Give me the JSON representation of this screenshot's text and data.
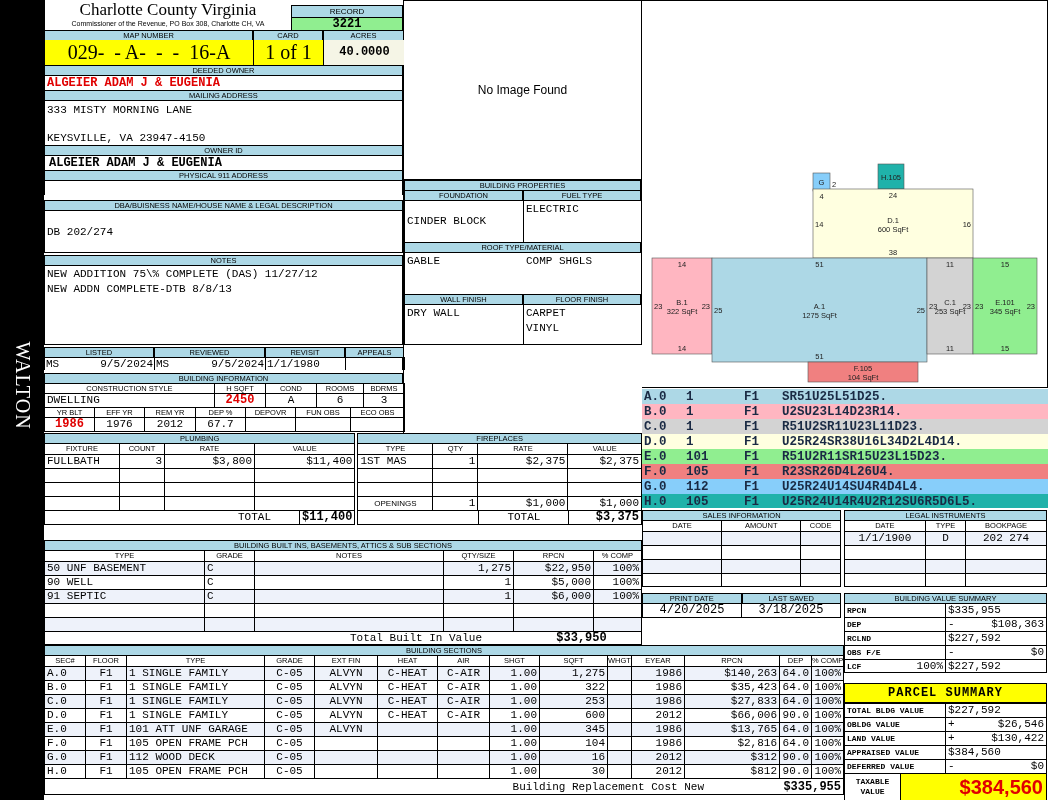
{
  "side_label": "WALTON",
  "header": {
    "county": "Charlotte County Virginia",
    "office": "Commissioner of the Revenue, PO Box 308, Charlotte CH, VA",
    "record_label": "RECORD",
    "record": "3221"
  },
  "parcel_id": [
    {
      "label": "MAP NUMBER",
      "value": "029-  - A-  -  -  16-A",
      "kind": "map"
    },
    {
      "label": "CARD",
      "value": "1 of 1",
      "kind": "map"
    },
    {
      "label": "ACRES",
      "value": "40.0000",
      "kind": "acres"
    }
  ],
  "owner_fields": [
    {
      "label": "DEEDED OWNER",
      "kind": "deeded",
      "lines": [
        "ALGEIER ADAM J & EUGENIA"
      ]
    },
    {
      "label": "MAILING ADDRESS",
      "kind": "address",
      "lines": [
        "333 MISTY MORNING LANE",
        "KEYSVILLE, VA 23947-4150"
      ]
    },
    {
      "label": "OWNER ID",
      "kind": "bold",
      "lines": [
        "ALGEIER ADAM J & EUGENIA"
      ]
    },
    {
      "label": "PHYSICAL 911 ADDRESS",
      "kind": "plain"
    }
  ],
  "description": {
    "label": "DBA/BUISNESS NAME/HOUSE NAME & LEGAL DESCRIPTION",
    "lines": [
      "DB 202/274"
    ]
  },
  "notes": {
    "label": "NOTES",
    "lines": [
      "NEW ADDITION 75\\% COMPLETE (DAS) 11/27/12",
      "NEW ADDN COMPLETE-DTB 8/8/13"
    ]
  },
  "dates": [
    {
      "label": "LISTED",
      "by": "MS",
      "date": "9/5/2024"
    },
    {
      "label": "REVIEWED",
      "by": "MS",
      "date": "9/5/2024"
    },
    {
      "label": "REVISIT",
      "date": "1/1/1980"
    },
    {
      "label": "APPEALS"
    }
  ],
  "building_info": {
    "title": "BUILDING INFORMATION",
    "style_row": [
      {
        "label": "CONSTRUCTION STYLE",
        "value": "DWELLING",
        "emphasis": false
      },
      {
        "label": "H SQFT",
        "value": "2450",
        "emphasis": true
      },
      {
        "label": "COND",
        "value": "A",
        "emphasis": false
      },
      {
        "label": "ROOMS",
        "value": "6",
        "emphasis": false
      },
      {
        "label": "BDRMS",
        "value": "3",
        "emphasis": false
      }
    ],
    "age_row": [
      {
        "label": "YR BLT",
        "value": "1986",
        "emphasis": true
      },
      {
        "label": "EFF YR",
        "value": "1976",
        "emphasis": false
      },
      {
        "label": "REM YR",
        "value": "2012",
        "emphasis": false
      },
      {
        "label": "DEP %",
        "value": "67.7",
        "emphasis": false
      },
      {
        "label": "DEPOVR"
      },
      {
        "label": "FUN OBS"
      },
      {
        "label": "ECO OBS"
      }
    ]
  },
  "image_box": {
    "text": "No Image Found"
  },
  "building_properties": {
    "title": "BUILDING PROPERTIES",
    "groups": [
      {
        "labels": [
          "FOUNDATION",
          "FUEL TYPE"
        ],
        "values": [
          [
            "CINDER BLOCK"
          ],
          [
            "ELECTRIC"
          ]
        ]
      },
      {
        "labels": [
          "ROOF TYPE/MATERIAL"
        ],
        "values": [
          [
            "GABLE"
          ],
          [
            "COMP SHGLS"
          ]
        ]
      },
      {
        "labels": [
          "WALL FINISH",
          "FLOOR FINISH"
        ],
        "values": [
          [
            "DRY WALL"
          ],
          [
            "CARPET",
            "VINYL"
          ]
        ]
      }
    ]
  },
  "sketch": {
    "areas": [
      {
        "label": "H.105",
        "color": "#20b2aa"
      },
      {
        "label": "G",
        "color": "#87cefa",
        "dims": [
          "2",
          "4"
        ]
      },
      {
        "label": "D.1",
        "area": "600 SqFt",
        "color": "#ffffe0",
        "dims": [
          "24",
          "14",
          "16",
          "38"
        ]
      },
      {
        "label": "B.1",
        "area": "322 SqFt",
        "color": "#ffb6c1",
        "dims": [
          "14",
          "14",
          "23",
          "23"
        ]
      },
      {
        "label": "A.1",
        "area": "1275 SqFt",
        "color": "#add8e6",
        "dims": [
          "51",
          "51",
          "25",
          "25"
        ]
      },
      {
        "label": "C.1",
        "area": "253 SqFt",
        "color": "#d3d3d3",
        "dims": [
          "11",
          "11",
          "23",
          "23"
        ]
      },
      {
        "label": "E.101",
        "area": "345 SqFt",
        "color": "#90ee90",
        "dims": [
          "15",
          "15",
          "23",
          "23"
        ]
      },
      {
        "label": "F.105",
        "area": "104 SqFt",
        "color": "#f08080"
      }
    ]
  },
  "section_vectors": [
    {
      "sec": "A.0",
      "code": "1",
      "floor": "F1",
      "vectors": "SR51U25L51D25.",
      "color": "#add8e6"
    },
    {
      "sec": "B.0",
      "code": "1",
      "floor": "F1",
      "vectors": "U2SU23L14D23R14.",
      "color": "#ffb6c1"
    },
    {
      "sec": "C.0",
      "code": "1",
      "floor": "F1",
      "vectors": "R51U2SR11U23L11D23.",
      "color": "#d3d3d3"
    },
    {
      "sec": "D.0",
      "code": "1",
      "floor": "F1",
      "vectors": "U25R24SR38U16L34D2L4D14.",
      "color": "#ffffe0"
    },
    {
      "sec": "E.0",
      "code": "101",
      "floor": "F1",
      "vectors": "R51U2R11SR15U23L15D23.",
      "color": "#90ee90"
    },
    {
      "sec": "F.0",
      "code": "105",
      "floor": "F1",
      "vectors": "R23SR26D4L26U4.",
      "color": "#f08080"
    },
    {
      "sec": "G.0",
      "code": "112",
      "floor": "F1",
      "vectors": "U25R24U14SU4R4D4L4.",
      "color": "#87cefa"
    },
    {
      "sec": "H.0",
      "code": "105",
      "floor": "F1",
      "vectors": "U25R24U14R4U2R12SU6R5D6L5.",
      "color": "#20b2aa"
    }
  ],
  "plumbing": {
    "title": "PLUMBING",
    "columns": [
      "FIXTURE",
      "COUNT",
      "RATE",
      "VALUE"
    ],
    "rows": [
      [
        "FULLBATH",
        "3",
        "$3,800",
        "$11,400"
      ]
    ],
    "total_label": "TOTAL",
    "total": "$11,400"
  },
  "fireplaces": {
    "title": "FIREPLACES",
    "columns": [
      "TYPE",
      "QTY",
      "RATE",
      "VALUE"
    ],
    "rows": [
      [
        "1ST MAS",
        "1",
        "$2,375",
        "$2,375"
      ]
    ],
    "openings": [
      "OPENINGS",
      "1",
      "$1,000",
      "$1,000"
    ],
    "total_label": "TOTAL",
    "total": "$3,375"
  },
  "built_ins": {
    "title": "BUILDING BUILT INS, BASEMENTS, ATTICS & SUB SECTIONS",
    "columns": [
      "TYPE",
      "GRADE",
      "NOTES",
      "QTY/SIZE",
      "RPCN",
      "% COMP"
    ],
    "rows": [
      {
        "type": "50 UNF BASEMENT",
        "grade": "C",
        "qty": "1,275",
        "rpcn": "$22,950",
        "comp": "100%"
      },
      {
        "type": "90 WELL",
        "grade": "C",
        "qty": "1",
        "rpcn": "$5,000",
        "comp": "100%"
      },
      {
        "type": "91 SEPTIC",
        "grade": "C",
        "qty": "1",
        "rpcn": "$6,000",
        "comp": "100%"
      }
    ],
    "total_label": "Total Built In Value",
    "total": "$33,950"
  },
  "building_sections": {
    "title": "BUILDING SECTIONS",
    "columns": [
      "SEC#",
      "FLOOR",
      "TYPE",
      "GRADE",
      "EXT FIN",
      "HEAT",
      "AIR",
      "SHGT",
      "SQFT",
      "WHGT",
      "EYEAR",
      "RPCN",
      "DEP",
      "% COMP"
    ],
    "rows": [
      {
        "sec": "A.0",
        "floor": "F1",
        "type": "1 SINGLE FAMILY",
        "grade": "C-05",
        "ext_fin": "ALVYN",
        "heat": "C-HEAT",
        "air": "C-AIR",
        "shgt": "1.00",
        "sqft": "1,275",
        "eyear": "1986",
        "rpcn": "$140,263",
        "dep": "64.0",
        "comp": "100%"
      },
      {
        "sec": "B.0",
        "floor": "F1",
        "type": "1 SINGLE FAMILY",
        "grade": "C-05",
        "ext_fin": "ALVYN",
        "heat": "C-HEAT",
        "air": "C-AIR",
        "shgt": "1.00",
        "sqft": "322",
        "eyear": "1986",
        "rpcn": "$35,423",
        "dep": "64.0",
        "comp": "100%"
      },
      {
        "sec": "C.0",
        "floor": "F1",
        "type": "1 SINGLE FAMILY",
        "grade": "C-05",
        "ext_fin": "ALVYN",
        "heat": "C-HEAT",
        "air": "C-AIR",
        "shgt": "1.00",
        "sqft": "253",
        "eyear": "1986",
        "rpcn": "$27,833",
        "dep": "64.0",
        "comp": "100%"
      },
      {
        "sec": "D.0",
        "floor": "F1",
        "type": "1 SINGLE FAMILY",
        "grade": "C-05",
        "ext_fin": "ALVYN",
        "heat": "C-HEAT",
        "air": "C-AIR",
        "shgt": "1.00",
        "sqft": "600",
        "eyear": "2012",
        "rpcn": "$66,006",
        "dep": "90.0",
        "comp": "100%"
      },
      {
        "sec": "E.0",
        "floor": "F1",
        "type": "101 ATT UNF GARAGE",
        "grade": "C-05",
        "ext_fin": "ALVYN",
        "shgt": "1.00",
        "sqft": "345",
        "eyear": "1986",
        "rpcn": "$13,765",
        "dep": "64.0",
        "comp": "100%"
      },
      {
        "sec": "F.0",
        "floor": "F1",
        "type": "105 OPEN FRAME PCH",
        "grade": "C-05",
        "shgt": "1.00",
        "sqft": "104",
        "eyear": "1986",
        "rpcn": "$2,816",
        "dep": "64.0",
        "comp": "100%"
      },
      {
        "sec": "G.0",
        "floor": "F1",
        "type": "112 WOOD DECK",
        "grade": "C-05",
        "shgt": "1.00",
        "sqft": "16",
        "eyear": "2012",
        "rpcn": "$312",
        "dep": "90.0",
        "comp": "100%"
      },
      {
        "sec": "H.0",
        "floor": "F1",
        "type": "105 OPEN FRAME PCH",
        "grade": "C-05",
        "shgt": "1.00",
        "sqft": "30",
        "eyear": "2012",
        "rpcn": "$812",
        "dep": "90.0",
        "comp": "100%"
      }
    ],
    "footer_label": "Building Replacement Cost New",
    "footer": "$335,955"
  },
  "sales": {
    "title": "SALES INFORMATION",
    "columns": [
      "DATE",
      "AMOUNT",
      "CODE"
    ]
  },
  "legal": {
    "title": "LEGAL INSTRUMENTS",
    "columns": [
      "DATE",
      "TYPE",
      "BOOKPAGE"
    ],
    "rows": [
      [
        "1/1/1900",
        "D",
        "202 274"
      ]
    ]
  },
  "record_dates": [
    {
      "label": "PRINT DATE",
      "value": "4/20/2025"
    },
    {
      "label": "LAST SAVED",
      "value": "3/18/2025"
    }
  ],
  "value_summary": {
    "title": "BUILDING VALUE SUMMARY",
    "rows": [
      {
        "label": "RPCN",
        "value": "$335,955"
      },
      {
        "label": "DEP",
        "sign": "-",
        "value": "$108,363"
      },
      {
        "label": "RCLND",
        "value": "$227,592"
      },
      {
        "label": "OBS F/E",
        "sign": "-",
        "value": "$0"
      },
      {
        "label": "LCF",
        "pct": "100%",
        "value": "$227,592"
      }
    ]
  },
  "parcel_summary": {
    "title": "PARCEL SUMMARY",
    "rows": [
      {
        "label": "TOTAL BLDG VALUE",
        "value": "$227,592"
      },
      {
        "label": "OBLDG VALUE",
        "sign": "+",
        "value": "$26,546"
      },
      {
        "label": "LAND VALUE",
        "sign": "+",
        "value": "$130,422"
      },
      {
        "label": "APPRAISED VALUE",
        "value": "$384,560"
      },
      {
        "label": "DEFERRED VALUE",
        "sign": "-",
        "value": "$0"
      }
    ],
    "taxable_label": "TAXABLE VALUE",
    "taxable": "$384,560"
  }
}
